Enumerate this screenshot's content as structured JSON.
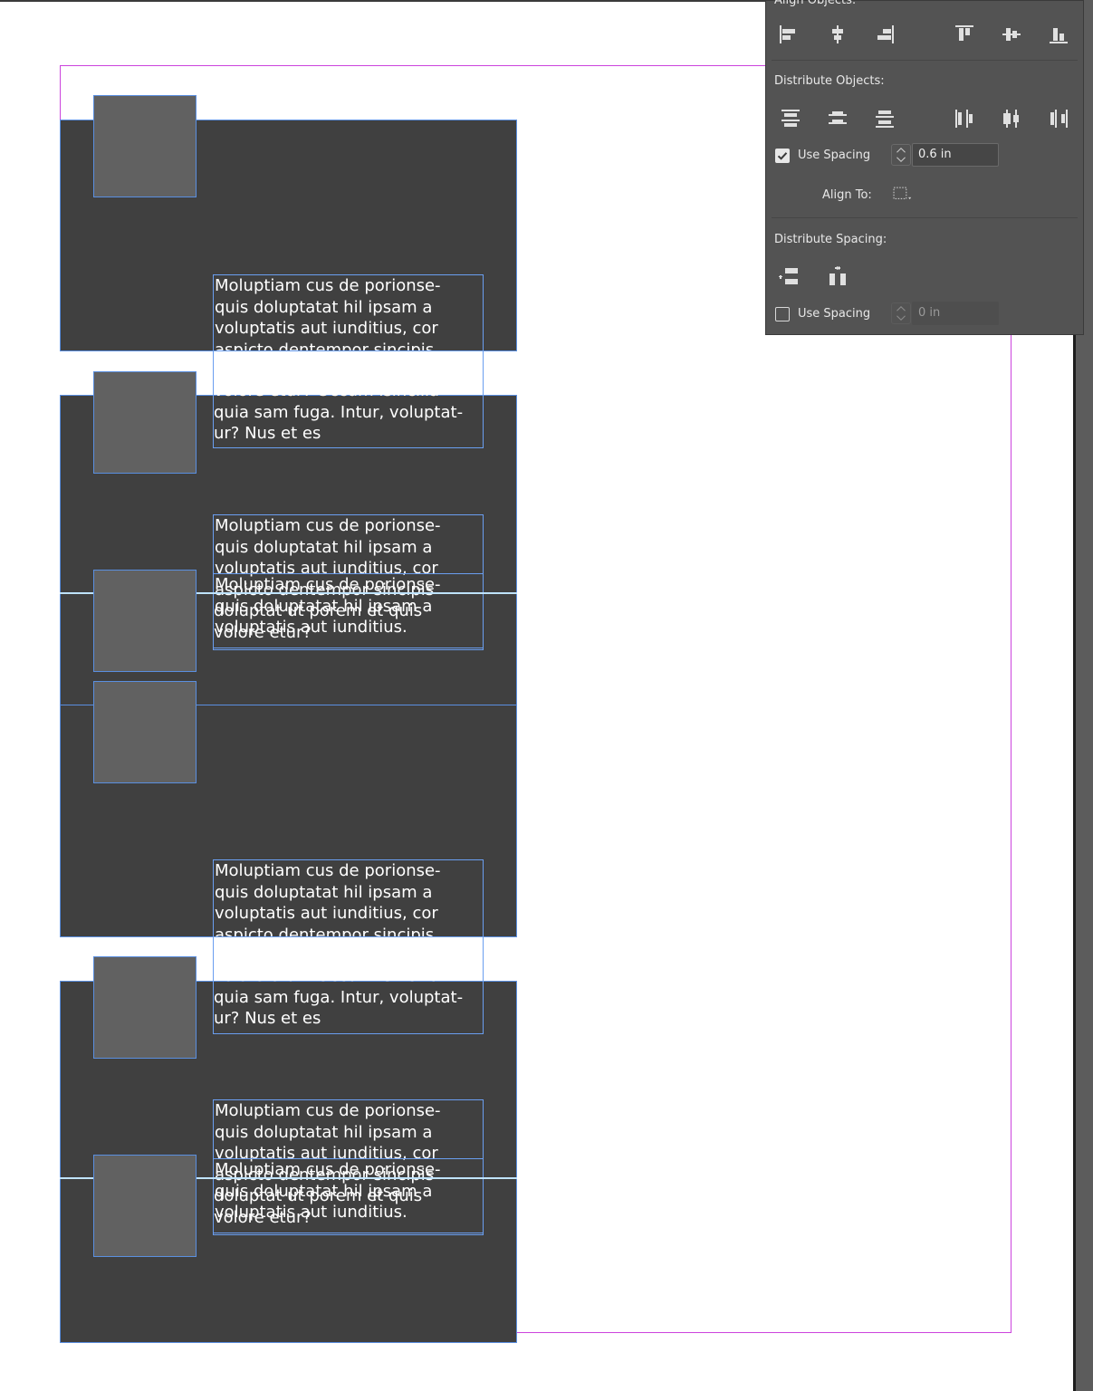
{
  "document": {
    "text_frames": [
      {
        "text": "Moluptiam cus de porionse-\nquis doluptatat hil ipsam a\nvoluptatis aut iunditius, cor\naspicto dentempor sincipis"
      },
      {
        "text": "volore etur? Occum isincilia\nquia sam fuga. Intur, voluptat-\nur? Nus et es"
      },
      {
        "text": "Moluptiam cus de porionse-\nquis doluptatat hil ipsam a\nvoluptatis aut iunditius, cor\naspicto dentempor sincipis"
      },
      {
        "text": "Moluptiam cus de porionse-\nquis doluptatat hil ipsam a\nvoluptatis aut iunditius."
      },
      {
        "text": "doluptat ut porem et quis\nvolore etur?"
      },
      {
        "text": "Moluptiam cus de porionse-\nquis doluptatat hil ipsam a\nvoluptatis aut iunditius, cor\naspicto dentempor sincipis"
      },
      {
        "text": "volore etur? Occum isincilia\nquia sam fuga. Intur, voluptat-\nur? Nus et es"
      },
      {
        "text": "Moluptiam cus de porionse-\nquis doluptatat hil ipsam a\nvoluptatis aut iunditius, cor\naspicto dentempor sincipis"
      },
      {
        "text": "Moluptiam cus de porionse-\nquis doluptatat hil ipsam a\nvoluptatis aut iunditius."
      },
      {
        "text": "doluptat ut porem et quis\nvolore etur?"
      }
    ]
  },
  "align_panel": {
    "align_objects_label": "Align Objects:",
    "align_objects_icons": [
      "align-left-edges-icon",
      "align-horizontal-centers-icon",
      "align-right-edges-icon",
      "align-top-edges-icon",
      "align-vertical-centers-icon",
      "align-bottom-edges-icon"
    ],
    "distribute_objects_label": "Distribute Objects:",
    "distribute_objects_icons": [
      "distribute-top-edges-icon",
      "distribute-vertical-centers-icon",
      "distribute-bottom-edges-icon",
      "distribute-left-edges-icon",
      "distribute-horizontal-centers-icon",
      "distribute-right-edges-icon"
    ],
    "use_spacing_1": {
      "label": "Use Spacing",
      "checked": true,
      "value": "0.6 in"
    },
    "align_to_label": "Align To:",
    "align_to_icon": "align-to-selection-icon",
    "distribute_spacing_label": "Distribute Spacing:",
    "distribute_spacing_icons": [
      "distribute-vertical-space-icon",
      "distribute-horizontal-space-icon"
    ],
    "use_spacing_2": {
      "label": "Use Spacing",
      "checked": false,
      "value": "0 in"
    }
  },
  "colors": {
    "canvas": "#ffffff",
    "dark_block": "#404040",
    "thumbnail": "#616161",
    "selection_frame": "#5a8fe0",
    "margin_guide": "#cc44dd",
    "panel_bg": "#535353"
  }
}
